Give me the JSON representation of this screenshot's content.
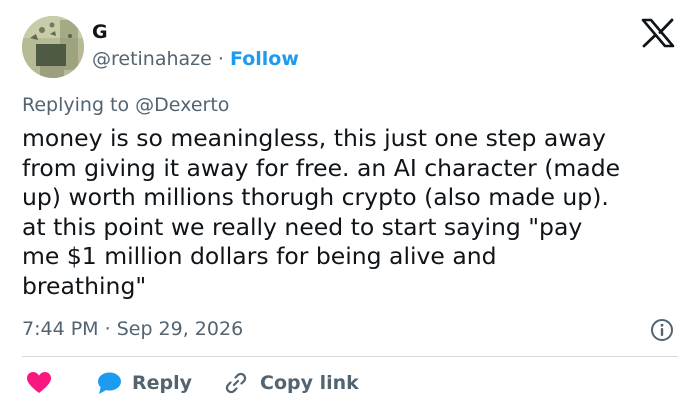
{
  "user": {
    "name": "G",
    "handle": "@retinahaze",
    "separator": "·",
    "follow_label": "Follow"
  },
  "reply_to": {
    "prefix": "Replying to",
    "mention": "@Dexerto"
  },
  "tweet": {
    "lines": [
      "money is so meaningless, this just one step away",
      "from giving it away for free. an AI character (made",
      "up) worth millions thorugh crypto (also made up).",
      "at this point we really need to start saying \"pay",
      "me $1 million dollars for being alive and",
      "breathing\""
    ]
  },
  "meta": {
    "time": "7:44 PM",
    "separator": "·",
    "date": "Sep 29, 2026"
  },
  "actions": {
    "reply_label": "Reply",
    "copy_link_label": "Copy link"
  },
  "colors": {
    "accent": "#1d9bf0",
    "like": "#f91880",
    "text": "#0f1419",
    "muted": "#536471"
  }
}
